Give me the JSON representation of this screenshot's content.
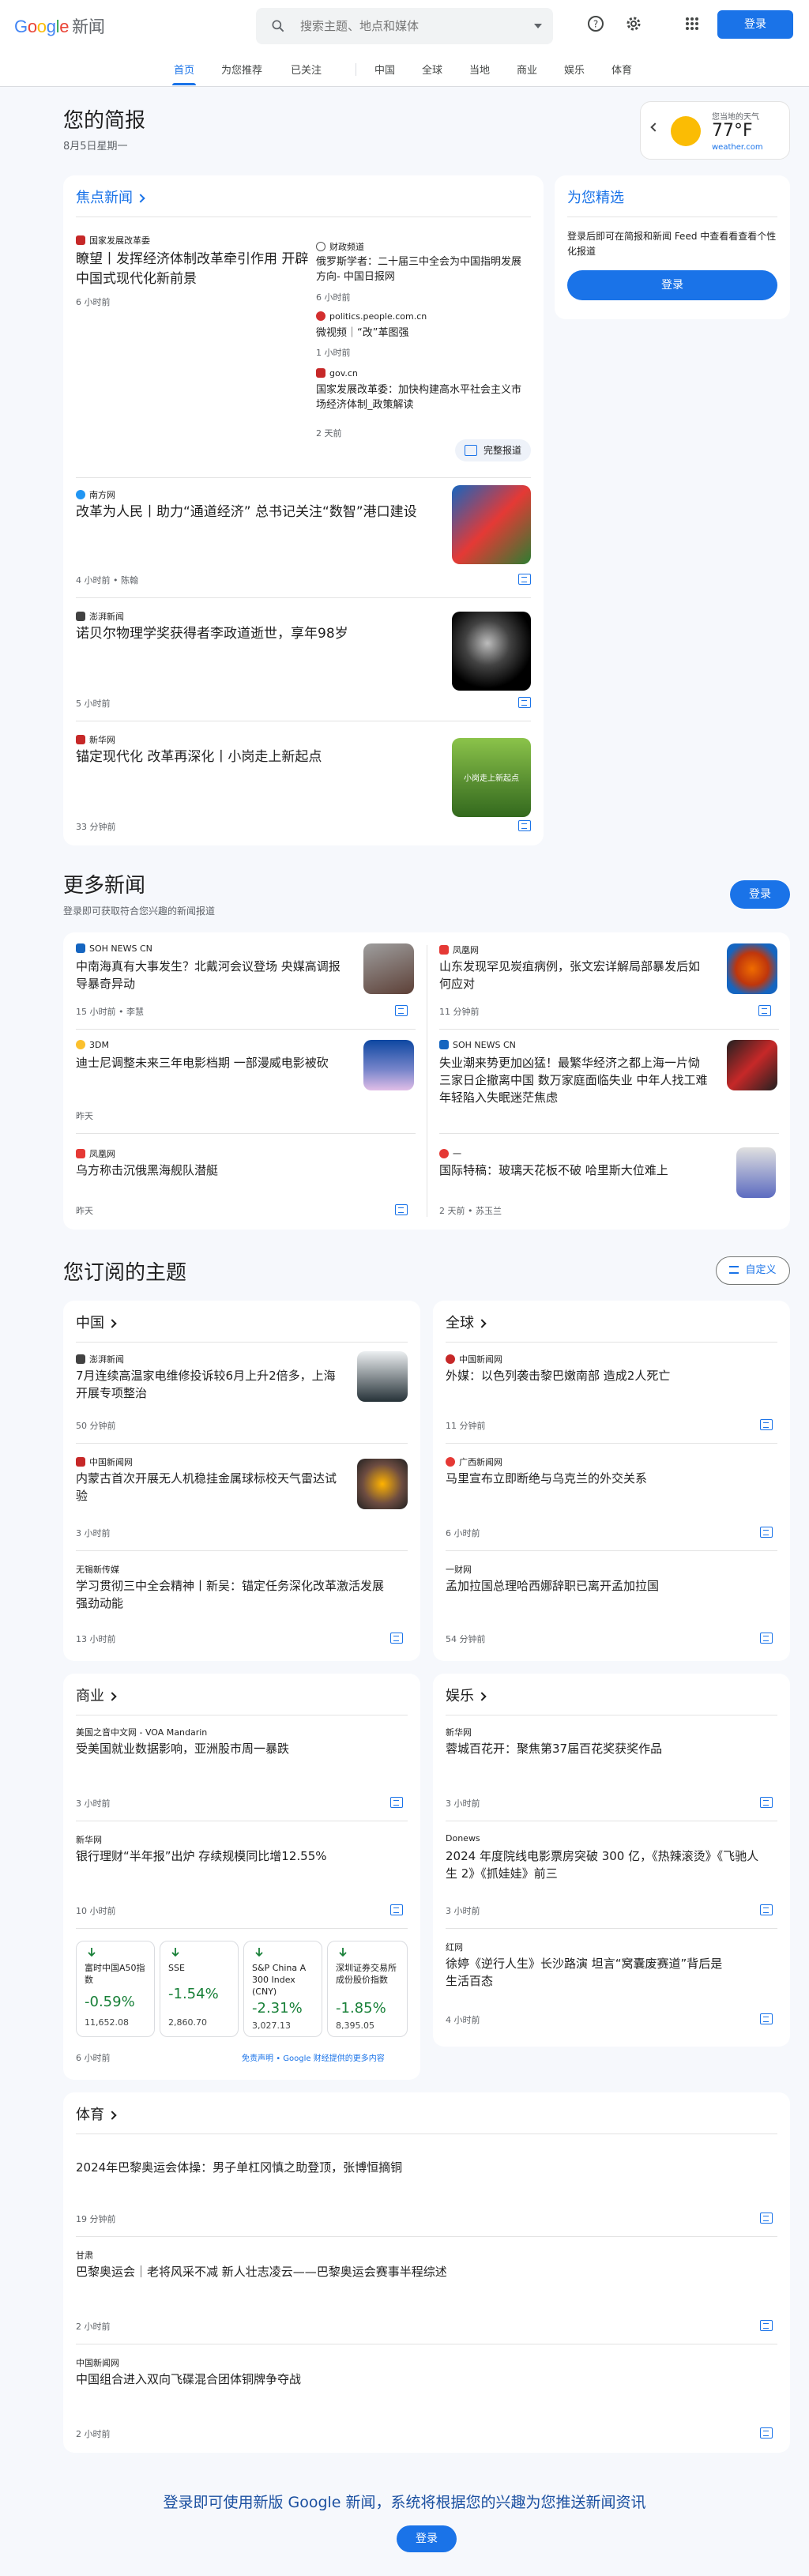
{
  "header": {
    "logo_google": "Google",
    "logo_news": "新闻",
    "search_placeholder": "搜索主题、地点和媒体",
    "signin": "登录"
  },
  "nav": {
    "tabs": [
      "首页",
      "为您推荐",
      "已关注",
      "中国",
      "全球",
      "当地",
      "商业",
      "娱乐",
      "体育"
    ]
  },
  "briefing": {
    "title": "您的简报",
    "date": "8月5日星期一"
  },
  "weather": {
    "label": "您当地的天气",
    "temp": "77°F",
    "source": "weather.com"
  },
  "top_stories": {
    "title": "焦点新闻",
    "lead": {
      "source": "国家发展改革委",
      "title": "瞭望丨发挥经济体制改革牵引作用 开辟中国式现代化新前景",
      "time": "6 小时前"
    },
    "side": [
      {
        "source": "财政频道",
        "title": "俄罗斯学者：二十届三中全会为中国指明发展方向- 中国日报网",
        "time": "6 小时前"
      },
      {
        "source": "politics.people.com.cn",
        "title": "微视频｜“改”革图强",
        "time": "1 小时前"
      },
      {
        "source": "gov.cn",
        "title": "国家发展改革委：加快构建高水平社会主义市场经济体制_政策解读",
        "time": "2 天前"
      }
    ],
    "full_coverage": "完整报道",
    "items": [
      {
        "source": "南方网",
        "title": "改革为人民丨助力“通道经济” 总书记关注“数智”港口建设",
        "time": "4 小时前 • 陈翰"
      },
      {
        "source": "澎湃新闻",
        "title": "诺贝尔物理学奖获得者李政道逝世，享年98岁",
        "time": "5 小时前"
      },
      {
        "source": "新华网",
        "title": "锚定现代化 改革再深化丨小岗走上新起点",
        "time": "33 分钟前",
        "thumb_text": "小岗走上新起点"
      }
    ]
  },
  "for_you": {
    "title": "为您精选",
    "desc": "登录后即可在简报和新闻 Feed 中查看看查看个性化报道",
    "signin": "登录"
  },
  "more_news": {
    "title": "更多新闻",
    "sub": "登录即可获取符合您兴趣的新闻报道",
    "signin": "登录",
    "items": [
      {
        "source": "SOH NEWS CN",
        "title": "中南海真有大事发生？北戴河会议登场 央媒高调报导暴奇异动",
        "time": "15 小时前 • 李慧"
      },
      {
        "source": "凤凰网",
        "title": "山东发现罕见炭疽病例，张文宏详解局部暴发后如何应对",
        "time": "11 分钟前"
      },
      {
        "source": "3DM",
        "title": "迪士尼调整未来三年电影档期 一部漫威电影被砍",
        "time": "昨天"
      },
      {
        "source": "SOH NEWS CN",
        "title": "失业潮来势更加凶猛！最繁华经济之都上海一片恸 三家日企撤离中国 数万家庭面临失业 中年人找工难 年轻陷入失眠迷茫焦虑",
        "time": ""
      },
      {
        "source": "凤凰网",
        "title": "乌方称击沉俄黑海舰队潜艇",
        "time": "昨天"
      },
      {
        "source": "一",
        "title": "国际特稿：玻璃天花板不破 哈里斯大位难上",
        "time": "2 天前 • 苏玉兰"
      }
    ]
  },
  "topics": {
    "title": "您订阅的主题",
    "customize": "自定义",
    "china": {
      "title": "中国",
      "items": [
        {
          "source": "澎湃新闻",
          "title": "7月连续高温家电维修投诉较6月上升2倍多，上海开展专项整治",
          "time": "50 分钟前"
        },
        {
          "source": "中国新闻网",
          "title": "内蒙古首次开展无人机稳挂金属球标校天气雷达试验",
          "time": "3 小时前"
        },
        {
          "source": "无锡新传媒",
          "title": "学习贯彻三中全会精神丨新吴：锚定任务深化改革激活发展强劲动能",
          "time": "13 小时前"
        }
      ]
    },
    "world": {
      "title": "全球",
      "items": [
        {
          "source": "中国新闻网",
          "title": "外媒：以色列袭击黎巴嫩南部 造成2人死亡",
          "time": "11 分钟前"
        },
        {
          "source": "广西新闻网",
          "title": "马里宣布立即断绝与乌克兰的外交关系",
          "time": "6 小时前"
        },
        {
          "source": "一财网",
          "title": "孟加拉国总理哈西娜辞职已离开孟加拉国",
          "time": "54 分钟前"
        }
      ]
    },
    "business": {
      "title": "商业",
      "items": [
        {
          "source": "美国之音中文网 - VOA Mandarin",
          "title": "受美国就业数据影响，亚洲股市周一暴跌",
          "time": "3 小时前"
        },
        {
          "source": "新华网",
          "title": "银行理财“半年报”出炉 存续规模同比增12.55%",
          "time": "10 小时前"
        }
      ],
      "stocks": [
        {
          "name": "富时中国A50指数",
          "pct": "-0.59%",
          "value": "11,652.08"
        },
        {
          "name": "SSE",
          "pct": "-1.54%",
          "value": "2,860.70"
        },
        {
          "name": "S&P China A 300 Index (CNY)",
          "pct": "-2.31%",
          "value": "3,027.13"
        },
        {
          "name": "深圳证券交易所成份股价指数",
          "pct": "-1.85%",
          "value": "8,395.05"
        }
      ],
      "stocks_time": "6 小时前",
      "disclaimer": "免责声明",
      "disclaimer_more": "• Google 财经提供的更多内容"
    },
    "entertainment": {
      "title": "娱乐",
      "items": [
        {
          "source": "新华网",
          "title": "蓉城百花开：聚焦第37届百花奖获奖作品",
          "time": "3 小时前"
        },
        {
          "source": "Donews",
          "title": "2024 年度院线电影票房突破 300 亿，《热辣滚烫》《飞驰人生 2》《抓娃娃》前三",
          "time": "3 小时前"
        },
        {
          "source": "红网",
          "title": "徐婷《逆行人生》长沙路演 坦言“窝囊废赛道”背后是生活百态",
          "time": "4 小时前"
        }
      ]
    },
    "sports": {
      "title": "体育",
      "items": [
        {
          "source": "",
          "title": "2024年巴黎奥运会体操：男子单杠冈慎之助登顶，张博恒摘铜",
          "time": "19 分钟前"
        },
        {
          "source": "甘肃",
          "title": "巴黎奥运会｜老将风采不减 新人壮志凌云——巴黎奥运会赛事半程综述",
          "time": "2 小时前"
        },
        {
          "source": "中国新闻网",
          "title": "中国组合进入双向飞碟混合团体铜牌争夺战",
          "time": "2 小时前"
        }
      ]
    }
  },
  "footer": {
    "text": "登录即可使用新版 Google 新闻，系统将根据您的兴趣为您推送新闻资讯",
    "signin": "登录"
  }
}
